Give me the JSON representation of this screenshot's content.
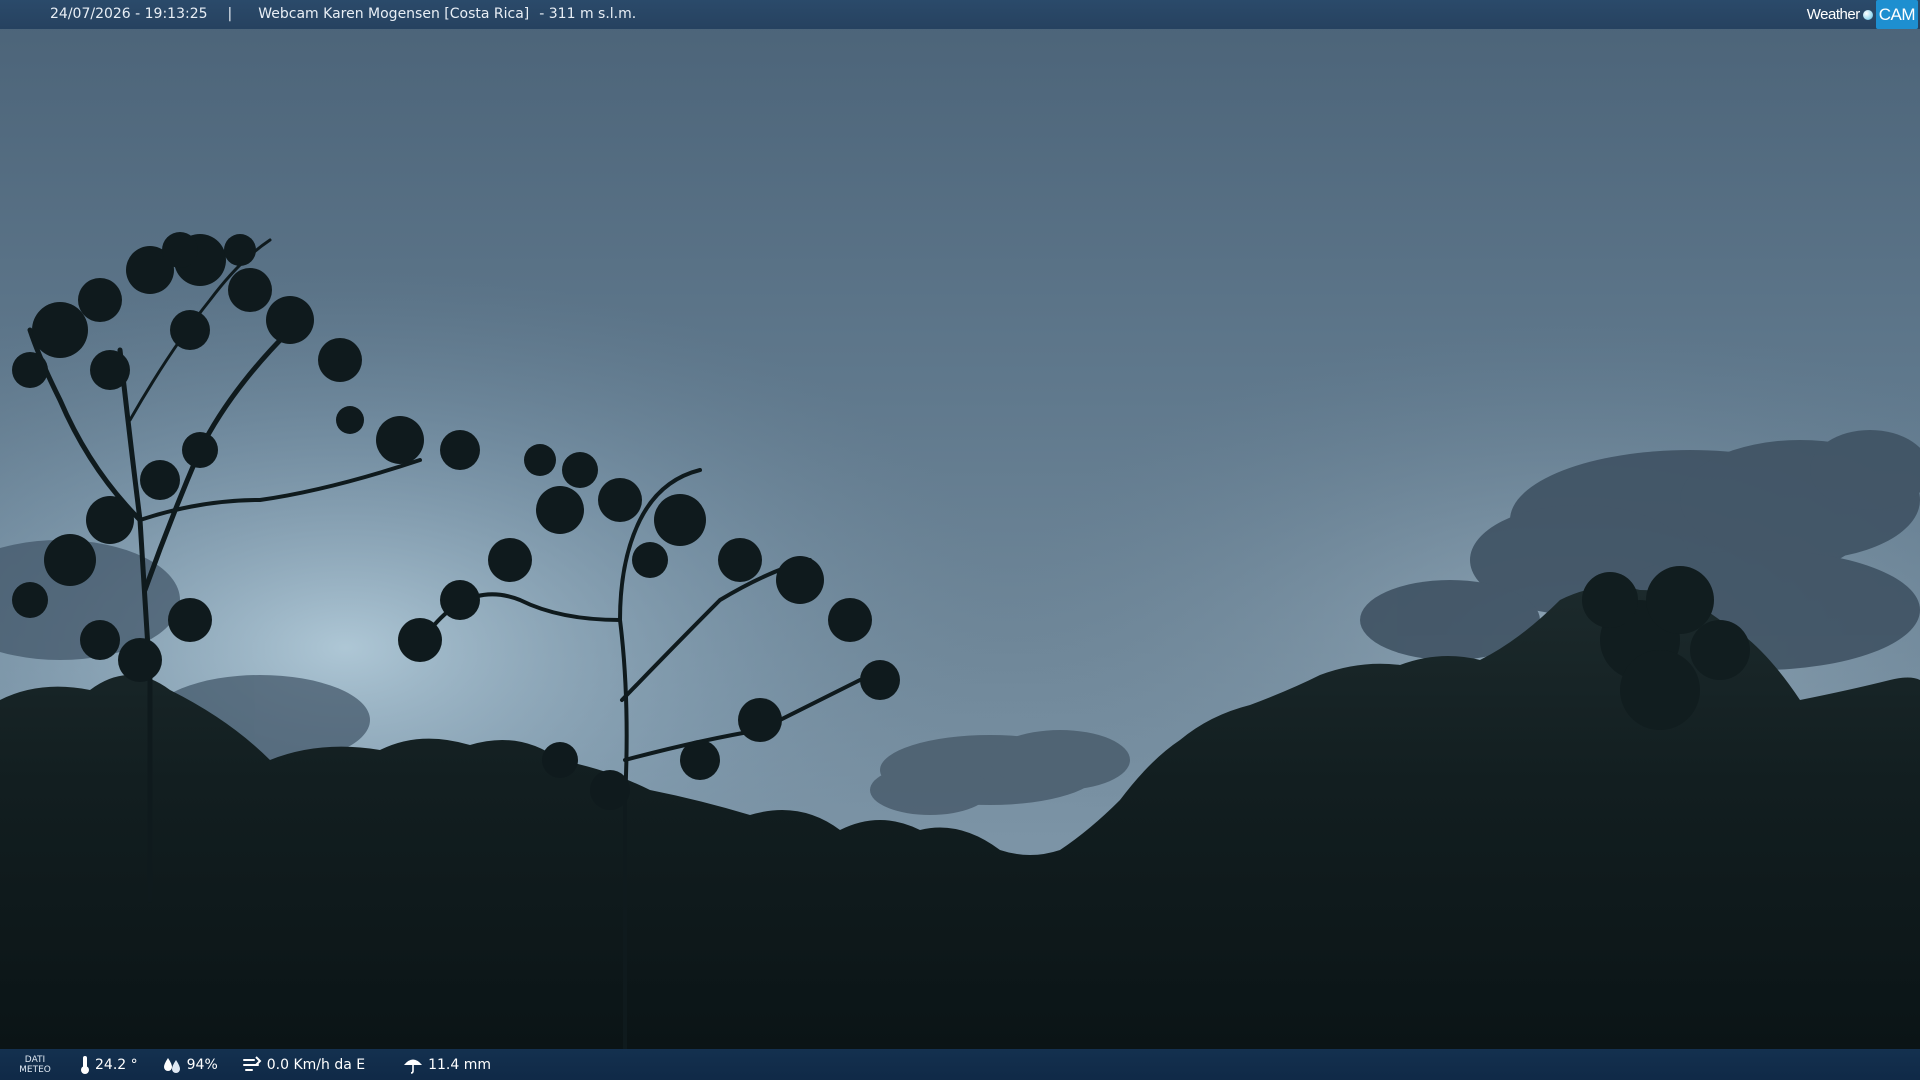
{
  "overlay": {
    "timestamp": "24/07/2026 - 19:13:25",
    "separator": "|",
    "title": "Webcam Karen Mogensen [Costa Rica]",
    "altitude": "- 311 m s.l.m."
  },
  "brand": {
    "weather": "Weather",
    "cam": "CAM"
  },
  "weather_data": {
    "label_line1": "DATI",
    "label_line2": "METEO",
    "temperature": "24.2 °",
    "humidity": "94%",
    "wind": "0.0 Km/h da E",
    "rain": "11.4 mm"
  },
  "colors": {
    "bar_top": "#284869",
    "bar_bottom": "#143252",
    "sky": "#5d7488",
    "forest": "#0e1a1c"
  }
}
